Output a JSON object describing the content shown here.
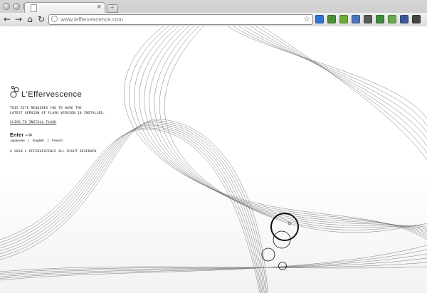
{
  "browser": {
    "tab_close_glyph": "×",
    "new_tab_glyph": "+",
    "address": "",
    "address_placeholder": "www.leffervescence.com",
    "nav_glyphs": {
      "back": "←",
      "forward": "→",
      "home": "⌂",
      "reload": "↻"
    },
    "star_glyph": "☆",
    "extensions": [
      {
        "name": "delicious-icon",
        "color": "#3274d1"
      },
      {
        "name": "translate-icon",
        "color": "#4a8f3a"
      },
      {
        "name": "evernote-icon",
        "color": "#6aaa3a"
      },
      {
        "name": "mail-icon",
        "color": "#4b74b8"
      },
      {
        "name": "camera-icon",
        "color": "#5a5a5a"
      },
      {
        "name": "search-icon",
        "color": "#3c8c3c"
      },
      {
        "name": "feed-icon",
        "color": "#6aa84f"
      },
      {
        "name": "facebook-icon",
        "color": "#3b5998"
      },
      {
        "name": "wrench-icon",
        "color": "#444444"
      }
    ]
  },
  "site": {
    "brand": "L'Effervescence",
    "notice_line1": "THIS SITE REQUIRES YOU TO HAVE THE",
    "notice_line2": "LATEST VERSION OF FLASH VERSION 10 INSTALLED.",
    "install_link": "CLICK TO INSTALL FLASH",
    "enter_label": "Enter",
    "enter_arrow": "-->",
    "languages": [
      "Japanese",
      "English",
      "French"
    ],
    "lang_separator": "|",
    "copyright": "© 2010 L'EFFERVESCENCE ALL RIGHT RESERVED"
  }
}
